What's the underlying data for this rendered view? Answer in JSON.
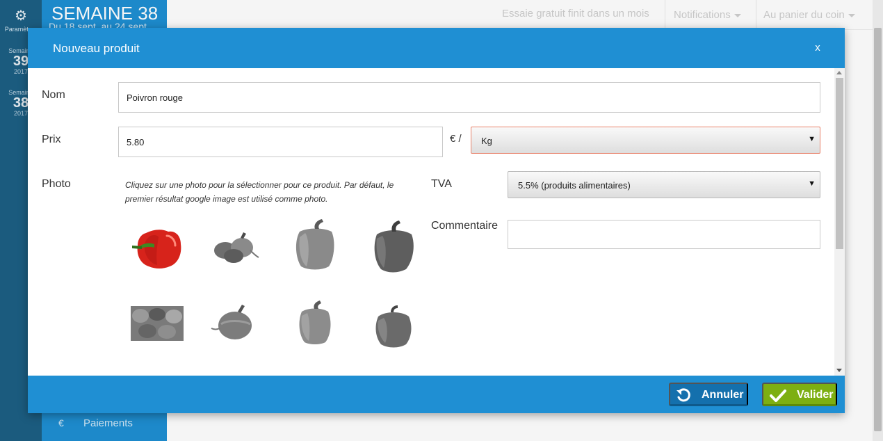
{
  "app": {
    "settings_label": "Paramètres",
    "weeks": [
      {
        "label": "Semaine",
        "number": "39",
        "year": "2017"
      },
      {
        "label": "Semaine",
        "number": "38",
        "year": "2017"
      }
    ],
    "current_week_title": "SEMAINE 38",
    "current_week_range": "Du 18 sept. au 24 sept.",
    "payments_label": "Paiements",
    "payments_icon": "€"
  },
  "topbar": {
    "trial_text": "Essaie gratuit finit dans un mois",
    "notifications_label": "Notifications",
    "shop_label": "Au panier du coin"
  },
  "modal": {
    "title": "Nouveau produit",
    "close_label": "x",
    "name": {
      "label": "Nom",
      "value": "Poivron rouge"
    },
    "price": {
      "label": "Prix",
      "value": "5.80",
      "separator": "€ /",
      "unit_selected": "Kg"
    },
    "photo": {
      "label": "Photo",
      "hint": "Cliquez sur une photo pour la sélectionner pour ce produit. Par défaut, le premier résultat google image est utilisé comme photo.",
      "count": 8,
      "selected_index": 0
    },
    "tva": {
      "label": "TVA",
      "selected": "5.5% (produits alimentaires)"
    },
    "comment": {
      "label": "Commentaire",
      "value": ""
    },
    "cancel_label": "Annuler",
    "ok_label": "Valider"
  },
  "colors": {
    "primary": "#1f8fd3",
    "dark_nav": "#1d5f84",
    "cancel_button": "#1470ad",
    "ok_button": "#7daf12",
    "error_border": "#e8826a"
  }
}
